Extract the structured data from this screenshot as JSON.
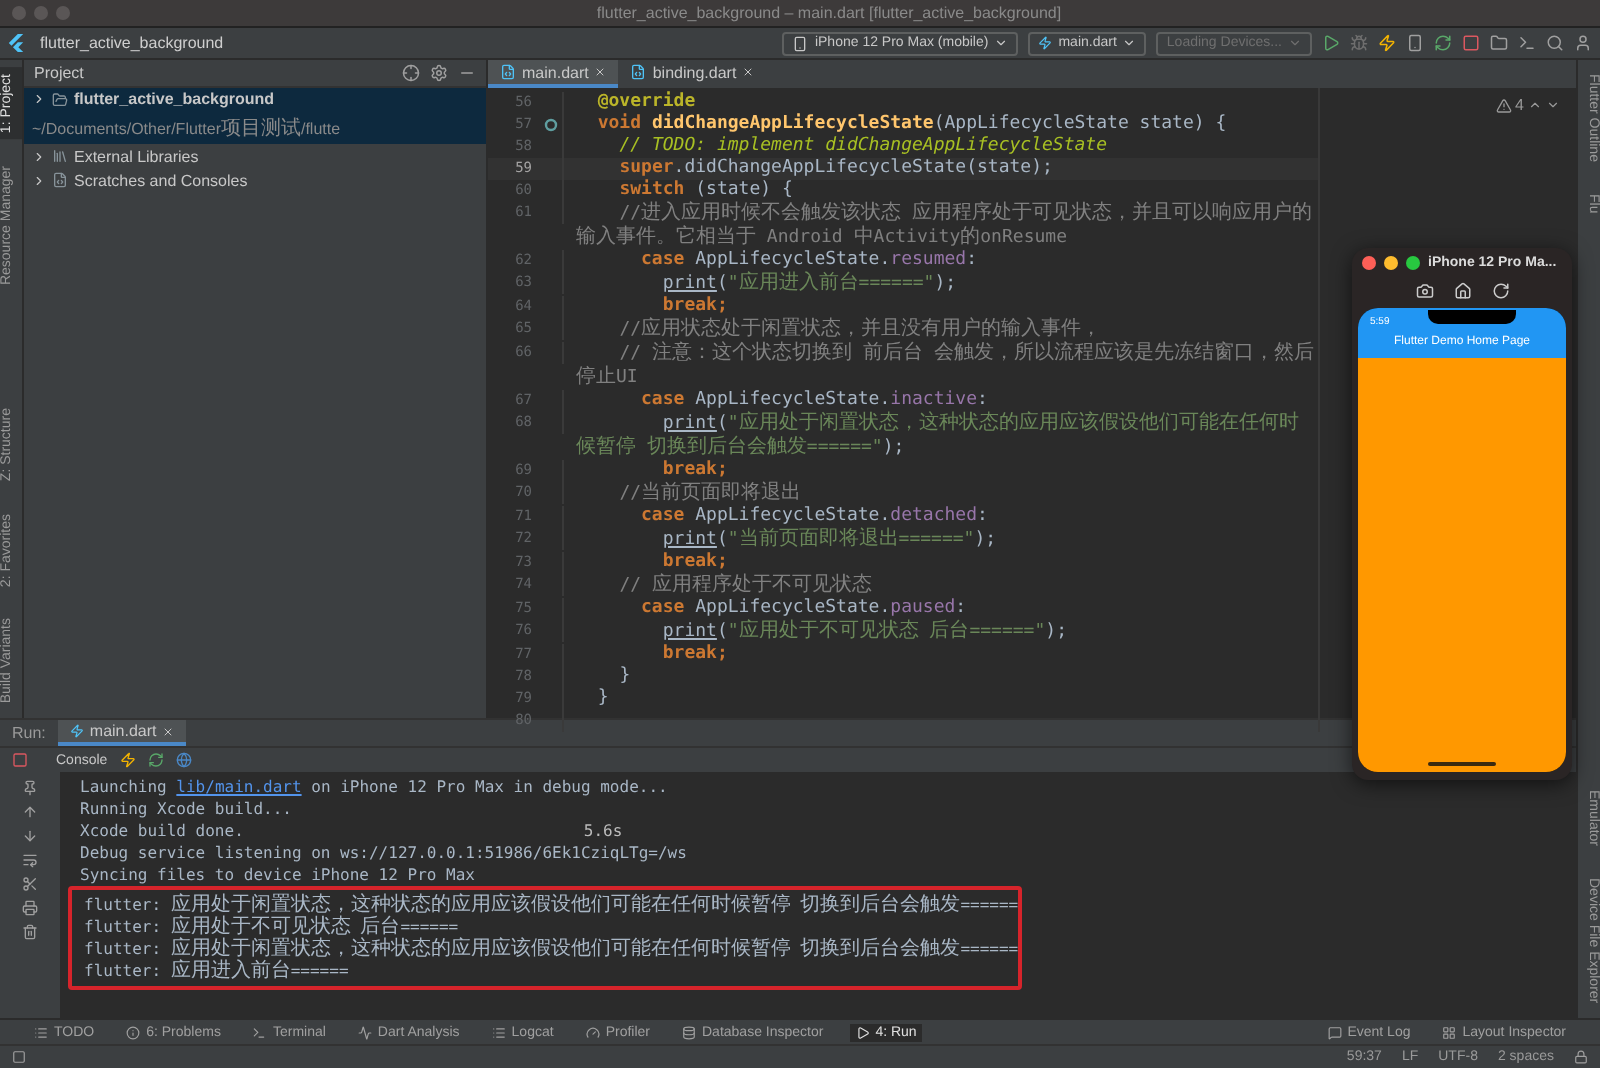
{
  "window": {
    "title": "flutter_active_background – main.dart [flutter_active_background]"
  },
  "toolbar": {
    "project": "flutter_active_background",
    "device": "iPhone 12 Pro Max (mobile)",
    "config": "main.dart",
    "devices": "Loading Devices..."
  },
  "left_strip": {
    "top": [
      {
        "label": "1: Project",
        "selected": true
      },
      {
        "label": "Resource Manager",
        "selected": false
      }
    ],
    "bottom": [
      {
        "label": "Z: Structure",
        "selected": false
      },
      {
        "label": "2: Favorites",
        "selected": false
      },
      {
        "label": "Build Variants",
        "selected": false
      }
    ]
  },
  "right_strip": {
    "top": [
      "Flutter Outline",
      "Flu"
    ],
    "bottom": [
      "Emulator",
      "Device File Explorer"
    ]
  },
  "project_panel": {
    "title": "Project",
    "items": [
      {
        "name": "flutter_active_background",
        "path": "~/Documents/Other/Flutter项目测试/flutte",
        "kind": "module",
        "selected": true
      },
      {
        "name": "External Libraries",
        "kind": "library",
        "selected": false
      },
      {
        "name": "Scratches and Consoles",
        "kind": "scratch",
        "selected": false
      }
    ]
  },
  "editor": {
    "tabs": [
      {
        "label": "main.dart",
        "selected": true
      },
      {
        "label": "binding.dart",
        "selected": false
      }
    ],
    "warnings": "4",
    "lines": [
      {
        "number": "56",
        "current": false,
        "segments": [
          {
            "text": "  @override",
            "kind": "anno"
          }
        ]
      },
      {
        "number": "57",
        "current": false,
        "override": true,
        "segments": [
          {
            "text": "  void ",
            "kind": "kw"
          },
          {
            "text": "didChangeAppLifecycleState",
            "kind": "fn"
          },
          {
            "text": "(AppLifecycleState state) {",
            "kind": "plain"
          }
        ]
      },
      {
        "number": "58",
        "current": false,
        "segments": [
          {
            "text": "    // TODO: implement didChangeAppLifecycleState",
            "kind": "todo"
          }
        ]
      },
      {
        "number": "59",
        "current": true,
        "segments": [
          {
            "text": "    super",
            "kind": "kw"
          },
          {
            "text": ".didChangeAppLifecycleState(state);",
            "kind": "plain"
          }
        ]
      },
      {
        "number": "60",
        "current": false,
        "segments": [
          {
            "text": "    switch ",
            "kind": "kw"
          },
          {
            "text": "(state) {",
            "kind": "plain"
          }
        ]
      },
      {
        "number": "61",
        "current": false,
        "segments": [
          {
            "text": "    //进入应用时候不会触发该状态 应用程序处于可见状态，并且可以响应用户的输入事件。它相当于 Android 中Activity的onResume",
            "kind": "comment"
          }
        ]
      },
      {
        "number": "62",
        "current": false,
        "segments": [
          {
            "text": "      case ",
            "kind": "kw"
          },
          {
            "text": "AppLifecycleState.",
            "kind": "plain"
          },
          {
            "text": "resumed",
            "kind": "field"
          },
          {
            "text": ":",
            "kind": "plain"
          }
        ]
      },
      {
        "number": "63",
        "current": false,
        "segments": [
          {
            "text": "        print",
            "kind": "call"
          },
          {
            "text": "(",
            "kind": "plain"
          },
          {
            "text": "\"应用进入前台======\"",
            "kind": "str"
          },
          {
            "text": ");",
            "kind": "plain"
          }
        ]
      },
      {
        "number": "64",
        "current": false,
        "segments": [
          {
            "text": "        break;",
            "kind": "kw"
          }
        ]
      },
      {
        "number": "65",
        "current": false,
        "segments": [
          {
            "text": "    //应用状态处于闲置状态，并且没有用户的输入事件，",
            "kind": "comment"
          }
        ]
      },
      {
        "number": "66",
        "current": false,
        "segments": [
          {
            "text": "    // 注意：这个状态切换到 前后台 会触发，所以流程应该是先冻结窗口，然后停止UI",
            "kind": "comment"
          }
        ]
      },
      {
        "number": "67",
        "current": false,
        "segments": [
          {
            "text": "      case ",
            "kind": "kw"
          },
          {
            "text": "AppLifecycleState.",
            "kind": "plain"
          },
          {
            "text": "inactive",
            "kind": "field"
          },
          {
            "text": ":",
            "kind": "plain"
          }
        ]
      },
      {
        "number": "68",
        "current": false,
        "segments": [
          {
            "text": "        print",
            "kind": "call"
          },
          {
            "text": "(",
            "kind": "plain"
          },
          {
            "text": "\"应用处于闲置状态，这种状态的应用应该假设他们可能在任何时候暂停 切换到后台会触发======\"",
            "kind": "str"
          },
          {
            "text": ");",
            "kind": "plain"
          }
        ]
      },
      {
        "number": "69",
        "current": false,
        "segments": [
          {
            "text": "        break;",
            "kind": "kw"
          }
        ]
      },
      {
        "number": "70",
        "current": false,
        "segments": [
          {
            "text": "    //当前页面即将退出",
            "kind": "comment"
          }
        ]
      },
      {
        "number": "71",
        "current": false,
        "segments": [
          {
            "text": "      case ",
            "kind": "kw"
          },
          {
            "text": "AppLifecycleState.",
            "kind": "plain"
          },
          {
            "text": "detached",
            "kind": "field"
          },
          {
            "text": ":",
            "kind": "plain"
          }
        ]
      },
      {
        "number": "72",
        "current": false,
        "segments": [
          {
            "text": "        print",
            "kind": "call"
          },
          {
            "text": "(",
            "kind": "plain"
          },
          {
            "text": "\"当前页面即将退出======\"",
            "kind": "str"
          },
          {
            "text": ");",
            "kind": "plain"
          }
        ]
      },
      {
        "number": "73",
        "current": false,
        "segments": [
          {
            "text": "        break;",
            "kind": "kw"
          }
        ]
      },
      {
        "number": "74",
        "current": false,
        "segments": [
          {
            "text": "    // 应用程序处于不可见状态",
            "kind": "comment"
          }
        ]
      },
      {
        "number": "75",
        "current": false,
        "segments": [
          {
            "text": "      case ",
            "kind": "kw"
          },
          {
            "text": "AppLifecycleState.",
            "kind": "plain"
          },
          {
            "text": "paused",
            "kind": "field"
          },
          {
            "text": ":",
            "kind": "plain"
          }
        ]
      },
      {
        "number": "76",
        "current": false,
        "segments": [
          {
            "text": "        print",
            "kind": "call"
          },
          {
            "text": "(",
            "kind": "plain"
          },
          {
            "text": "\"应用处于不可见状态 后台======\"",
            "kind": "str"
          },
          {
            "text": ");",
            "kind": "plain"
          }
        ]
      },
      {
        "number": "77",
        "current": false,
        "segments": [
          {
            "text": "        break;",
            "kind": "kw"
          }
        ]
      },
      {
        "number": "78",
        "current": false,
        "segments": [
          {
            "text": "    }",
            "kind": "plain"
          }
        ]
      },
      {
        "number": "79",
        "current": false,
        "segments": [
          {
            "text": "  }",
            "kind": "plain"
          }
        ]
      },
      {
        "number": "80",
        "current": false
      }
    ]
  },
  "simulator": {
    "title": "iPhone 12 Pro Ma...",
    "time": "5:59",
    "app_title": "Flutter Demo Home Page"
  },
  "run_panel": {
    "label": "Run:",
    "tab": "main.dart",
    "console_tab": "Console",
    "lines": [
      {
        "highlighted": false,
        "segments": [
          {
            "text": "Launching ",
            "kind": "plain"
          },
          {
            "text": "lib/main.dart",
            "kind": "link"
          },
          {
            "text": " on iPhone 12 Pro Max in debug mode...",
            "kind": "plain"
          }
        ]
      },
      {
        "highlighted": false,
        "segments": [
          {
            "text": "Running Xcode build...",
            "kind": "plain"
          }
        ]
      },
      {
        "highlighted": false,
        "segments": [
          {
            "text": "Xcode build done.",
            "kind": "plain"
          },
          {
            "text": "5.6s",
            "kind": "timing"
          }
        ]
      },
      {
        "highlighted": false,
        "segments": [
          {
            "text": "Debug service listening on ws://127.0.0.1:51986/6Ek1CziqLTg=/ws",
            "kind": "plain"
          }
        ]
      },
      {
        "highlighted": false,
        "segments": [
          {
            "text": "Syncing files to device iPhone 12 Pro Max",
            "kind": "plain"
          }
        ]
      },
      {
        "highlighted": true,
        "segments": [
          {
            "text": "flutter: 应用处于闲置状态，这种状态的应用应该假设他们可能在任何时候暂停 切换到后台会触发======",
            "kind": "plain"
          }
        ]
      },
      {
        "highlighted": true,
        "segments": [
          {
            "text": "flutter: 应用处于不可见状态 后台======",
            "kind": "plain"
          }
        ]
      },
      {
        "highlighted": true,
        "segments": [
          {
            "text": "flutter: 应用处于闲置状态，这种状态的应用应该假设他们可能在任何时候暂停 切换到后台会触发======",
            "kind": "plain"
          }
        ]
      },
      {
        "highlighted": true,
        "segments": [
          {
            "text": "flutter: 应用进入前台======",
            "kind": "plain"
          }
        ]
      }
    ]
  },
  "tool_windows": {
    "left": [
      {
        "label": "TODO",
        "kind": "todo",
        "selected": false
      },
      {
        "label": "6: Problems",
        "kind": "problems",
        "selected": false
      },
      {
        "label": "Terminal",
        "kind": "terminal",
        "selected": false
      },
      {
        "label": "Dart Analysis",
        "kind": "dart",
        "selected": false
      },
      {
        "label": "Logcat",
        "kind": "logcat",
        "selected": false
      },
      {
        "label": "Profiler",
        "kind": "profiler",
        "selected": false
      },
      {
        "label": "Database Inspector",
        "kind": "database",
        "selected": false
      },
      {
        "label": "4: Run",
        "kind": "run",
        "selected": true
      }
    ],
    "right": [
      {
        "label": "Event Log",
        "kind": "event",
        "selected": false
      },
      {
        "label": "Layout Inspector",
        "kind": "layout",
        "selected": false
      }
    ]
  },
  "status_bar": [
    "59:37",
    "LF",
    "UTF-8",
    "2 spaces"
  ]
}
